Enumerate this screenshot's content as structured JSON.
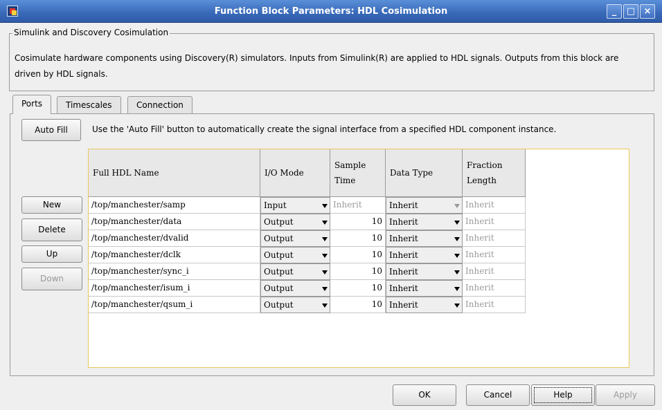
{
  "window": {
    "title": "Function Block Parameters: HDL Cosimulation",
    "controls": [
      "_",
      "□",
      "×"
    ]
  },
  "group": {
    "legend": "Simulink and Discovery Cosimulation",
    "description": "Cosimulate hardware components using Discovery(R) simulators. Inputs from Simulink(R) are applied to HDL signals. Outputs from this block are driven by HDL signals."
  },
  "tabs": [
    {
      "label": "Ports",
      "active": true
    },
    {
      "label": "Timescales",
      "active": false
    },
    {
      "label": "Connection",
      "active": false
    }
  ],
  "ports": {
    "autofill_label": "Auto Fill",
    "autofill_desc": "Use the 'Auto Fill' button to automatically create the signal interface from a specified HDL component instance.",
    "side_buttons": {
      "new": "New",
      "delete": "Delete",
      "up": "Up",
      "down": "Down"
    },
    "columns": {
      "name": "Full HDL Name",
      "io_mode": "I/O Mode",
      "sample_time": "Sample Time",
      "data_type": "Data Type",
      "fraction_length": "Fraction Length"
    },
    "rows": [
      {
        "name": "/top/manchester/samp",
        "io_mode": "Input",
        "sample_time": "Inherit",
        "data_type": "Inherit",
        "fraction_length": "Inherit"
      },
      {
        "name": "/top/manchester/data",
        "io_mode": "Output",
        "sample_time": "10",
        "data_type": "Inherit",
        "fraction_length": "Inherit"
      },
      {
        "name": "/top/manchester/dvalid",
        "io_mode": "Output",
        "sample_time": "10",
        "data_type": "Inherit",
        "fraction_length": "Inherit"
      },
      {
        "name": "/top/manchester/dclk",
        "io_mode": "Output",
        "sample_time": "10",
        "data_type": "Inherit",
        "fraction_length": "Inherit"
      },
      {
        "name": "/top/manchester/sync_i",
        "io_mode": "Output",
        "sample_time": "10",
        "data_type": "Inherit",
        "fraction_length": "Inherit"
      },
      {
        "name": "/top/manchester/isum_i",
        "io_mode": "Output",
        "sample_time": "10",
        "data_type": "Inherit",
        "fraction_length": "Inherit"
      },
      {
        "name": "/top/manchester/qsum_i",
        "io_mode": "Output",
        "sample_time": "10",
        "data_type": "Inherit",
        "fraction_length": "Inherit"
      }
    ]
  },
  "footer": {
    "ok": "OK",
    "cancel": "Cancel",
    "help": "Help",
    "apply": "Apply"
  }
}
